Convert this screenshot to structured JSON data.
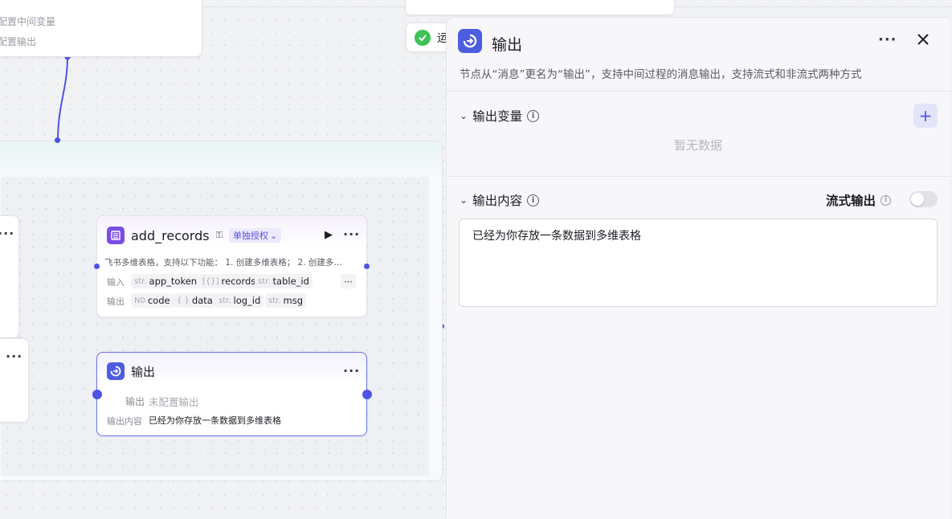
{
  "top_node": {
    "line1": "配置中间变量",
    "line2": "配置输出"
  },
  "status_node": {
    "text": "运"
  },
  "add_records_node": {
    "title": "add_records",
    "auth_tag": "单独授权",
    "description": "飞书多维表格，支持以下功能： 1. 创建多维表格； 2. 创建多…",
    "input_label": "输入",
    "output_label": "输出",
    "inputs": [
      {
        "type": "str.",
        "name": "app_token"
      },
      {
        "type": "[{}]",
        "name": "records"
      },
      {
        "type": "str.",
        "name": "table_id"
      }
    ],
    "outputs": [
      {
        "type": "N0",
        "name": "code"
      },
      {
        "type": "{ }",
        "name": "data"
      },
      {
        "type": "str.",
        "name": "log_id"
      },
      {
        "type": "str.",
        "name": "msg"
      }
    ]
  },
  "output_node": {
    "title": "输出",
    "output_label": "输出",
    "output_value": "未配置输出",
    "content_label": "输出内容",
    "content_value": "已经为你存放一条数据到多维表格"
  },
  "panel": {
    "title": "输出",
    "description": "节点从“消息”更名为“输出”，支持中间过程的消息输出，支持流式和非流式两种方式",
    "section_vars": "输出变量",
    "empty_text": "暂无数据",
    "section_content": "输出内容",
    "stream_label": "流式输出",
    "content_text": "已经为你存放一条数据到多维表格"
  },
  "colors": {
    "accent": "#4d53e8",
    "node_purple": "#7a4fe0",
    "status_green": "#3ec254"
  }
}
